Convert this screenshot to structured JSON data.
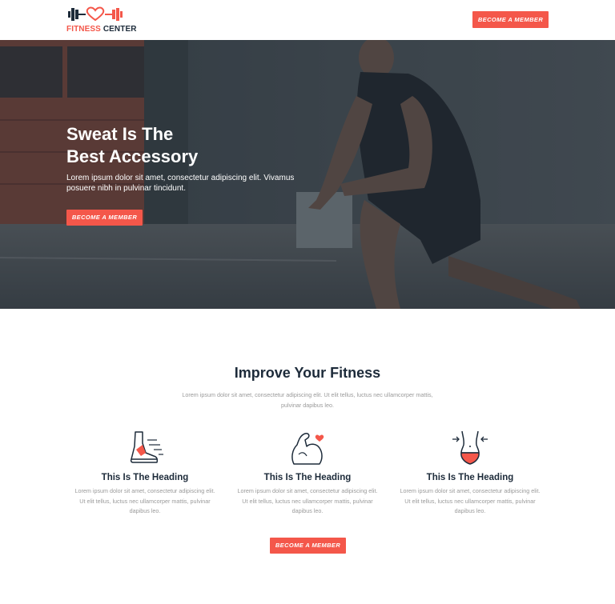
{
  "header": {
    "logo_word1": "FITNESS",
    "logo_word2": "CENTER",
    "cta_label": "BECOME A MEMBER"
  },
  "hero": {
    "title_line1": "Sweat Is The",
    "title_line2": "Best Accessory",
    "text": "Lorem ipsum dolor sit amet, consectetur adipiscing elit. Vivamus posuere nibh in pulvinar tincidunt.",
    "cta_label": "BECOME A MEMBER"
  },
  "features_section": {
    "title": "Improve Your Fitness",
    "text": "Lorem ipsum dolor sit amet, consectetur adipiscing elit. Ut elit tellus, luctus nec ullamcorper mattis, pulvinar dapibus leo.",
    "items": [
      {
        "icon": "running-shoe-icon",
        "title": "This Is The Heading",
        "text": "Lorem ipsum dolor sit amet, consectetur adipiscing elit. Ut elit tellus, luctus nec ullamcorper mattis, pulvinar dapibus leo."
      },
      {
        "icon": "flexed-arm-heart-icon",
        "title": "This Is The Heading",
        "text": "Lorem ipsum dolor sit amet, consectetur adipiscing elit. Ut elit tellus, luctus nec ullamcorper mattis, pulvinar dapibus leo."
      },
      {
        "icon": "waist-measure-icon",
        "title": "This Is The Heading",
        "text": "Lorem ipsum dolor sit amet, consectetur adipiscing elit. Ut elit tellus, luctus nec ullamcorper mattis, pulvinar dapibus leo."
      }
    ],
    "cta_label": "BECOME A MEMBER"
  },
  "colors": {
    "accent": "#f4574a",
    "dark": "#1d2b3a",
    "muted_text": "#9a9a9a"
  }
}
